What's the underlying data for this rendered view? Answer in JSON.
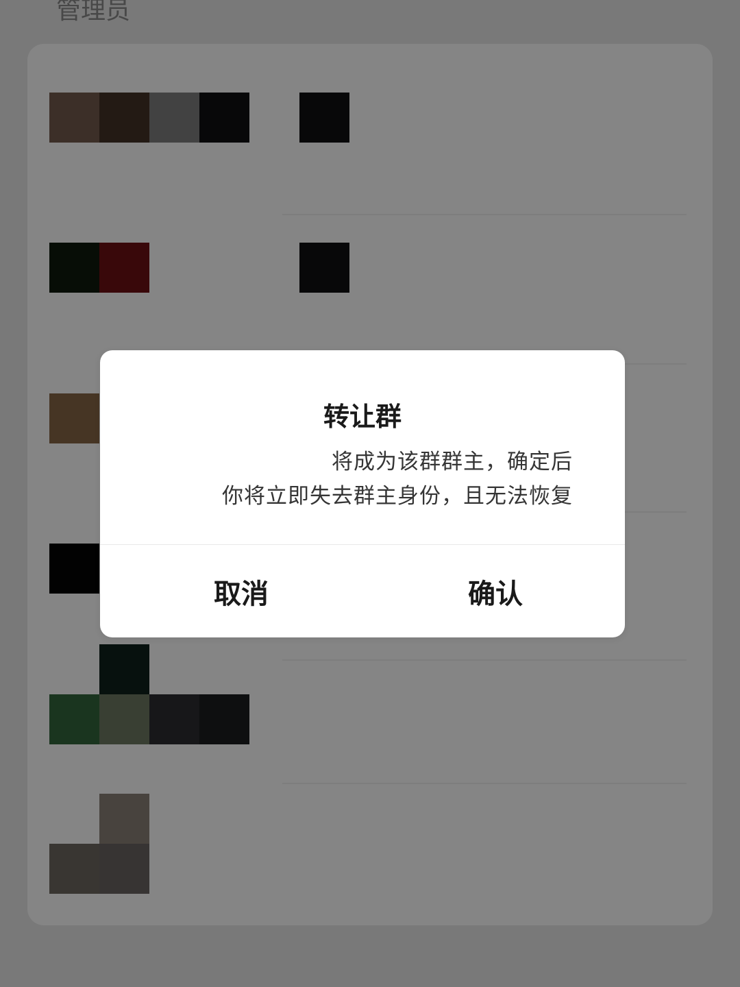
{
  "background": {
    "section_label": "管理员"
  },
  "dialog": {
    "title": "转让群",
    "message_line1": "将成为该群群主，确定后",
    "message_line2": "你将立即失去群主身份，且无法恢复",
    "cancel_label": "取消",
    "confirm_label": "确认"
  },
  "colors": {
    "overlay": "#000000",
    "dialog_bg": "#ffffff",
    "text_primary": "#1a1a1a"
  }
}
